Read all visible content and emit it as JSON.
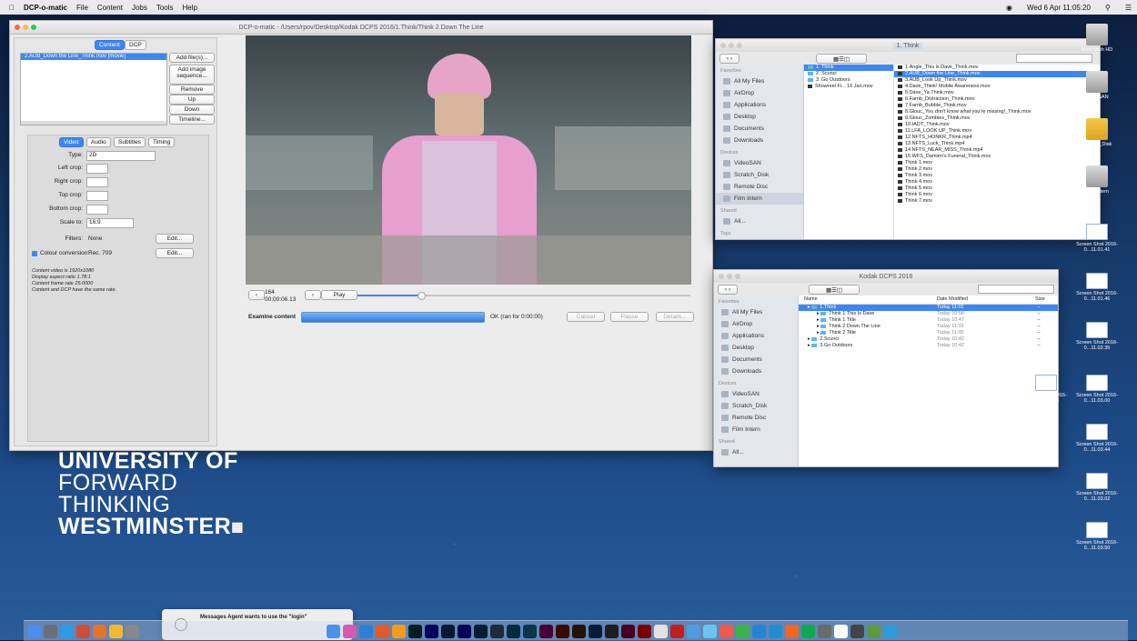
{
  "menubar": {
    "app": "DCP-o-matic",
    "items": [
      "File",
      "Content",
      "Jobs",
      "Tools",
      "Help"
    ],
    "clock": "Wed 6 Apr 11:05:20"
  },
  "dcp": {
    "title": "DCP-o-matic - /Users/rpov/Desktop/Kodak DCPS 2016/1.Think/Think 2 Down The Line",
    "tabs": [
      "Content",
      "DCP"
    ],
    "content_item": "2.AUB_Down the Line_Think.mov [movie]",
    "side_buttons": [
      "Add file(s)...",
      "Add image sequence...",
      "Remove",
      "Up",
      "Down",
      "Timeline..."
    ],
    "subtabs": [
      "Video",
      "Audio",
      "Subtitles",
      "Timing"
    ],
    "type_label": "Type:",
    "type_value": "2D",
    "left_crop": "Left crop:",
    "right_crop": "Right crop:",
    "top_crop": "Top crop:",
    "bottom_crop": "Bottom crop:",
    "scale_label": "Scale to:",
    "scale_value": "16:9",
    "filters_label": "Filters:",
    "filters_value": "None",
    "edit": "Edit...",
    "colour_label": "Colour conversion",
    "colour_value": "Rec. 709",
    "info": [
      "Content video is 1920x1080",
      "Display aspect ratio 1.78:1",
      "Content frame rate 25.0000",
      "Content and DCP have the same rate."
    ],
    "frame": "164",
    "timecode": "00:00:06.13",
    "play": "Play",
    "examine": "Examine content",
    "ok_text": "OK (ran for 0:00:00)",
    "job_buttons": [
      "Cancel",
      "Pause",
      "Details..."
    ]
  },
  "finder1": {
    "title": "1. Think",
    "favorites_label": "Favorites",
    "sidebar": [
      "All My Files",
      "AirDrop",
      "Applications",
      "Desktop",
      "Documents",
      "Downloads"
    ],
    "devices_label": "Devices",
    "devices": [
      "VideoSAN",
      "Scratch_Disk",
      "Remote Disc",
      "Film Intern"
    ],
    "shared_label": "Shared",
    "shared": [
      "All..."
    ],
    "tags_label": "Tags",
    "col1": [
      "1. Think",
      "2. Scunci",
      "3. Go Outdoors",
      "Showreel Fi... 16 Jan.mov"
    ],
    "col2": [
      "1.Angle_This is Dave_Think.mov",
      "2.AUB_Down the Line_Think.mov",
      "3.AUB_Look Up_Think.mov",
      "4.Dave_Think! Mobile Awareness.mov",
      "5.Dave_Ya Think.mov",
      "6.Farnb_Distraction_Think.mov",
      "7.Farnb_Bubble_Think.mov",
      "8.Glouc_You don't know what you're missing!_Think.mov",
      "9.Glouc_Zombies_Think.mov",
      "10.IADT_Think.mov",
      "11.LFA_LOOK UP_Think.mov",
      "12.NFTS_HONKR_Think.mp4",
      "13.NFTS_Luck_Think.mp4",
      "14.NFTS_NEAR_MISS_Think.mp4",
      "15.WFS_Damien's Funeral_Think.mov",
      "Think 1.mov",
      "Think 2.mov",
      "Think 3.mov",
      "Think 4.mov",
      "Think 5.mov",
      "Think 6.mov",
      "Think 7.mov"
    ]
  },
  "finder2": {
    "title": "Kodak DCPS 2016",
    "headers": [
      "Name",
      "Date Modified",
      "Size"
    ],
    "rows": [
      {
        "name": "1.Think",
        "date": "Today 11:02",
        "size": "--"
      },
      {
        "name": "Think 1 This Is Dave",
        "date": "Today 10:56",
        "size": "--"
      },
      {
        "name": "Think 1 Title",
        "date": "Today 10:47",
        "size": "--"
      },
      {
        "name": "Think 2 Down The Line",
        "date": "Today 11:03",
        "size": "--"
      },
      {
        "name": "Think 2 Title",
        "date": "Today 11:00",
        "size": "--"
      },
      {
        "name": "2.Scunci",
        "date": "Today 10:42",
        "size": "--"
      },
      {
        "name": "3.Go Outdoors",
        "date": "Today 10:42",
        "size": "--"
      }
    ]
  },
  "desktop": {
    "icons": [
      "Macintosh HD",
      "VideoSAN",
      "Scratch_Disk",
      "Film Intern",
      "Screen Shot 2016-0...11.01.41",
      "Screen Shot 2016-0...11.01.46",
      "Screen Shot 2016-0...11.02.35",
      "Screen Shot 2016-0...11.03.06",
      "Screen Shot 2016-0...11.03.00",
      "Screen Shot 2016-0...11.03.44",
      "Screen Shot 2016-0...11.03.02",
      "Screen Shot 2016-0...11.03.50"
    ],
    "brand": [
      "UNIVERSITY OF",
      "FORWARD",
      "THINKING",
      "WESTMINSTER"
    ]
  },
  "notification": {
    "text": "Messages Agent wants to use the \"login\""
  }
}
